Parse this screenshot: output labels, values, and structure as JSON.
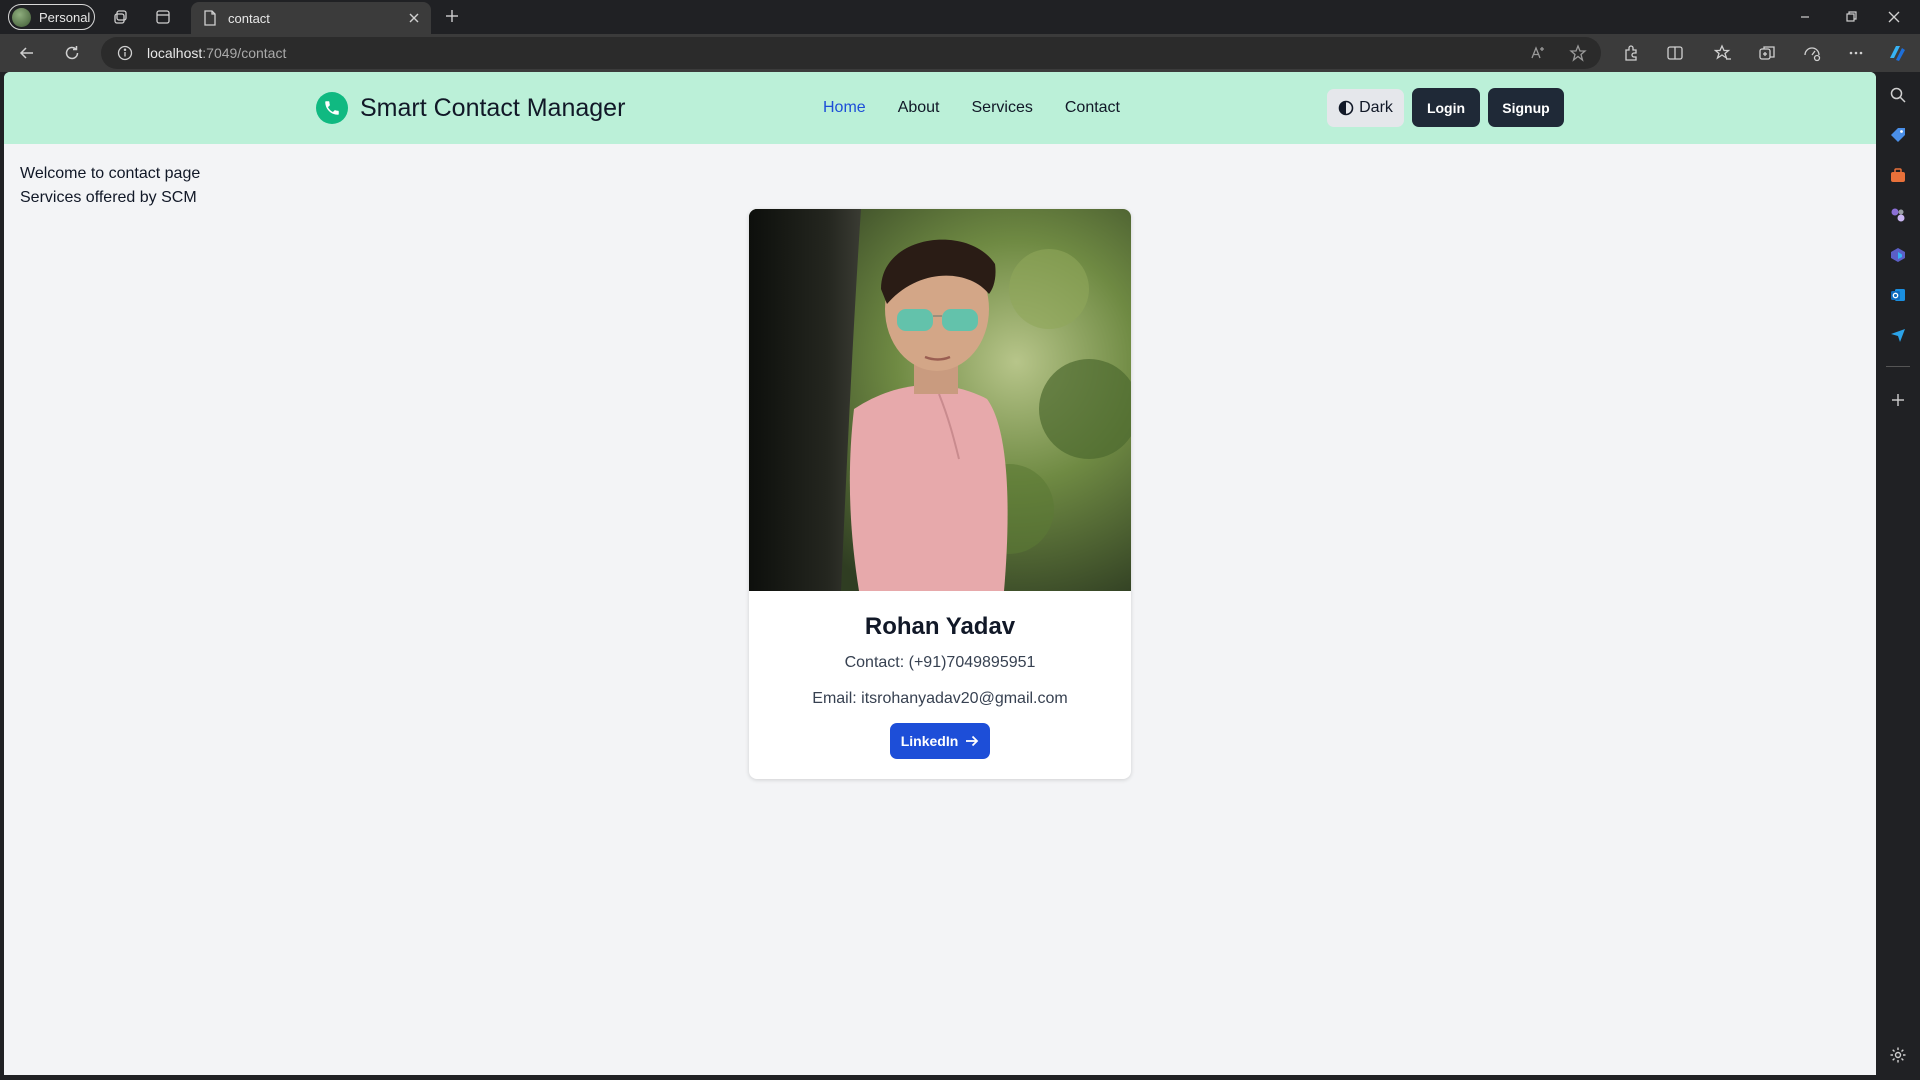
{
  "browser": {
    "profile_label": "Personal",
    "tab_title": "contact",
    "address_host": "localhost",
    "address_path": ":7049/contact"
  },
  "site": {
    "brand_name": "Smart Contact Manager",
    "nav": [
      {
        "label": "Home",
        "active": true
      },
      {
        "label": "About",
        "active": false
      },
      {
        "label": "Services",
        "active": false
      },
      {
        "label": "Contact",
        "active": false
      }
    ],
    "theme_toggle_label": "Dark",
    "login_label": "Login",
    "signup_label": "Signup"
  },
  "intro": {
    "line1": "Welcome to contact page",
    "line2": "Services offered by SCM"
  },
  "card": {
    "name": "Rohan Yadav",
    "contact": "Contact: (+91)7049895951",
    "email": "Email: itsrohanyadav20@gmail.com",
    "button_label": "LinkedIn"
  },
  "colors": {
    "navbar_bg": "#bbf0d8",
    "brand_green": "#10b981",
    "link_active": "#1d4ed8",
    "button_dark": "#1f2937",
    "linkedin_blue": "#1d4ed8"
  },
  "icons": {
    "brand": "phone-icon",
    "theme": "half-circle-icon",
    "linkedin": "arrow-right-icon"
  }
}
